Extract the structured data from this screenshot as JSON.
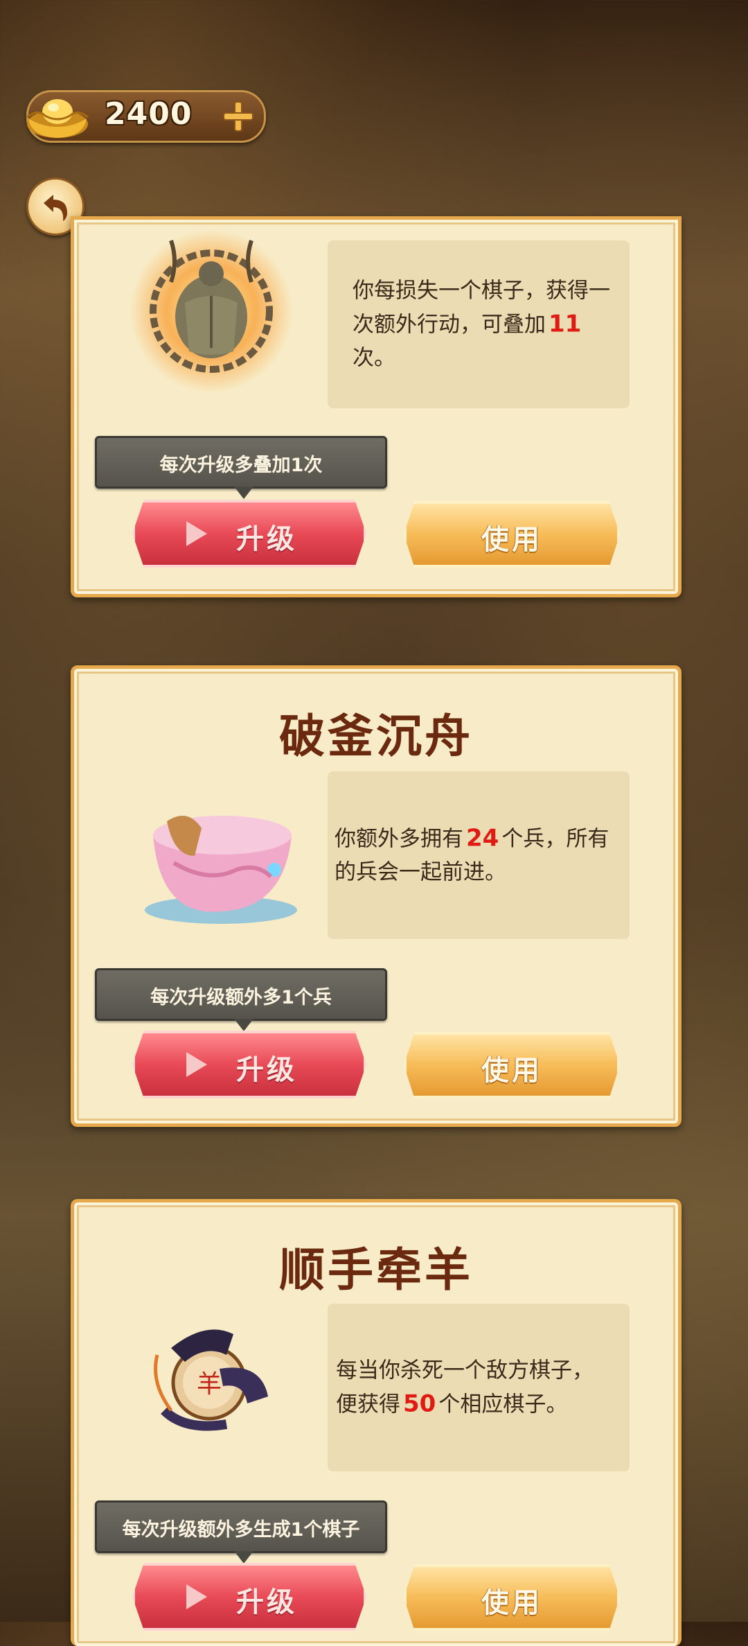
{
  "header": {
    "currency_amount": "2400",
    "currency_icon": "gold-ingot-icon",
    "add_icon": "plus-icon",
    "back_icon": "back-arrow-icon"
  },
  "cards": [
    {
      "title": "",
      "art": "chained-warrior-art",
      "desc_pre": "你每损失一个棋子，获得一次额外行动，可叠加",
      "desc_value": "11",
      "desc_post": "次。",
      "tip": "每次升级多叠加1次",
      "upgrade_label": "升级",
      "use_label": "使用"
    },
    {
      "title": "破釜沉舟",
      "art": "broken-cauldron-boat-art",
      "desc_pre": "你额外多拥有",
      "desc_value": "24",
      "desc_post": "个兵，所有的兵会一起前进。",
      "tip": "每次升级额外多1个兵",
      "upgrade_label": "升级",
      "use_label": "使用"
    },
    {
      "title": "顺手牵羊",
      "art": "grabbing-claw-chess-piece-art",
      "desc_pre": "每当你杀死一个敌方棋子，便获得",
      "desc_value": "50",
      "desc_post": "个相应棋子。",
      "tip": "每次升级额外多生成1个棋子",
      "upgrade_label": "升级",
      "use_label": "使用"
    }
  ],
  "colors": {
    "highlight": "#e01b14",
    "title": "#6b2a10",
    "card_bg": "#f8ecc8",
    "upgrade_red": "#e84a56",
    "use_gold": "#f7bc58"
  }
}
